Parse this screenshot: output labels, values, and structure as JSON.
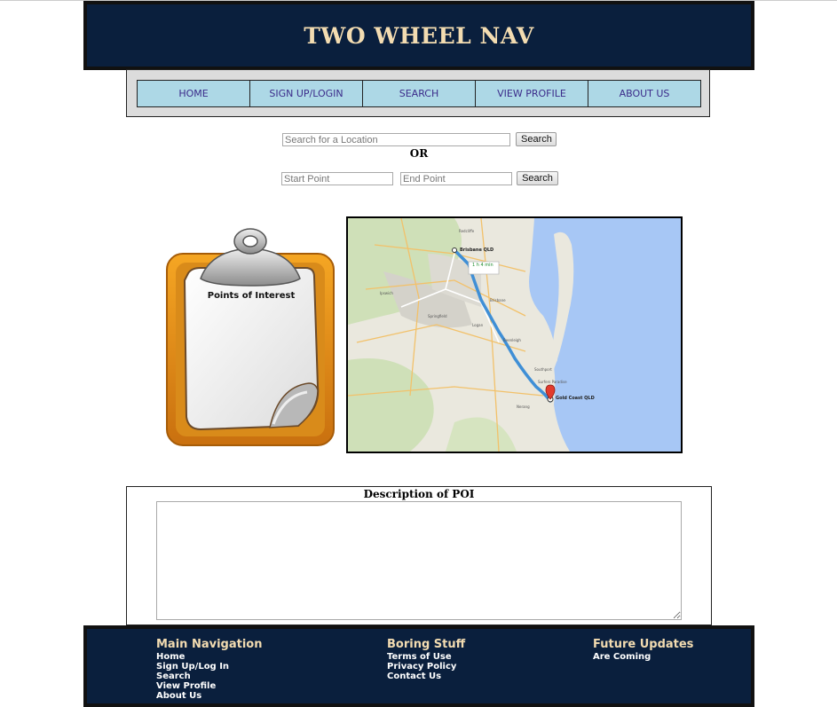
{
  "header": {
    "title": "TWO WHEEL NAV"
  },
  "nav": {
    "items": [
      {
        "label": "HOME"
      },
      {
        "label": "SIGN UP/LOGIN"
      },
      {
        "label": "SEARCH"
      },
      {
        "label": "VIEW PROFILE"
      },
      {
        "label": "ABOUT US"
      }
    ]
  },
  "search": {
    "location_placeholder": "Search for a Location",
    "search_label": "Search",
    "or_label": "OR",
    "start_placeholder": "Start Point",
    "end_placeholder": "End Point",
    "route_search_label": "Search"
  },
  "poi": {
    "clipboard_label": "Points of Interest",
    "description_title": "Description of POI",
    "description_value": ""
  },
  "map": {
    "origin_label": "Brisbane QLD",
    "destination_label": "Gold Coast QLD",
    "duration": "1 h 4 min",
    "places": [
      "Redcliffe",
      "Brisbane",
      "Logan",
      "Beenleigh",
      "Southport",
      "Surfers Paradise",
      "Nerang",
      "Ipswich",
      "Springfield"
    ]
  },
  "footer": {
    "main_nav": {
      "title": "Main Navigation",
      "links": [
        "Home",
        "Sign Up/Log In",
        "Search",
        "View Profile",
        "About Us"
      ]
    },
    "boring": {
      "title": "Boring Stuff",
      "links": [
        "Terms of Use",
        "Privacy Policy",
        "Contact Us"
      ]
    },
    "future": {
      "title": "Future Updates",
      "links": [
        "Are Coming"
      ]
    }
  },
  "colors": {
    "header_bg": "#0a1f3d",
    "title_color": "#f3dcb1",
    "nav_button_bg": "#add8e6",
    "nav_text": "#3b2b8a",
    "water": "#a7c7f5",
    "route": "#3f8fd6"
  }
}
